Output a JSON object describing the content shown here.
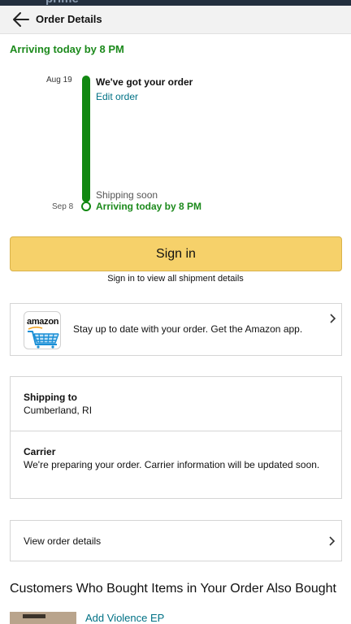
{
  "statusbar": {
    "brand_fragment": "prime"
  },
  "header": {
    "title": "Order Details"
  },
  "delivery": {
    "headline": "Arriving today by 8 PM"
  },
  "tracker": {
    "start_date": "Aug 19",
    "start_label": "We've got your order",
    "edit_link": "Edit order",
    "pending_label": "Shipping soon",
    "end_date": "Sep 8",
    "end_label": "Arriving today by 8 PM"
  },
  "signin": {
    "button_label": "Sign in",
    "note": "Sign in to view all shipment details"
  },
  "app_promo": {
    "icon_word": "amazon",
    "text": "Stay up to date with your order. Get the Amazon app."
  },
  "shipping": {
    "to_label": "Shipping to",
    "to_value": "Cumberland, RI",
    "carrier_label": "Carrier",
    "carrier_value": "We're preparing your order. Carrier information will be updated soon."
  },
  "order_details": {
    "link_label": "View order details"
  },
  "recommendations": {
    "heading": "Customers Who Bought Items in Your Order Also Bought",
    "items": [
      {
        "title": "Add Violence EP"
      }
    ]
  },
  "colors": {
    "success_green": "#1c8a1c",
    "link_teal": "#007185",
    "button_yellow": "#f6d16a",
    "top_bar": "#232f3e"
  }
}
